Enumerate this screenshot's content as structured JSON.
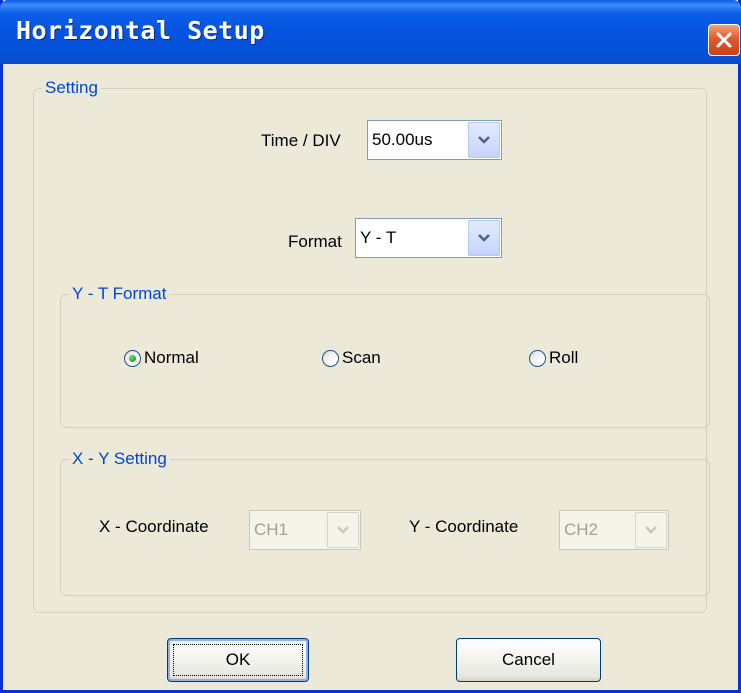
{
  "window": {
    "title": "Horizontal Setup",
    "close_icon": "close-icon"
  },
  "setting": {
    "legend": "Setting",
    "time_div": {
      "label": "Time / DIV",
      "value": "50.00us"
    },
    "format": {
      "label": "Format",
      "value": "Y - T"
    }
  },
  "yt_format": {
    "legend": "Y - T Format",
    "options": [
      {
        "label": "Normal",
        "selected": true
      },
      {
        "label": "Scan",
        "selected": false
      },
      {
        "label": "Roll",
        "selected": false
      }
    ]
  },
  "xy_setting": {
    "legend": "X - Y Setting",
    "x_coordinate": {
      "label": "X - Coordinate",
      "value": "CH1",
      "enabled": false
    },
    "y_coordinate": {
      "label": "Y - Coordinate",
      "value": "CH2",
      "enabled": false
    }
  },
  "buttons": {
    "ok": "OK",
    "cancel": "Cancel"
  },
  "colors": {
    "title_bar": "#0553e0",
    "group_legend": "#0046d5",
    "close_button": "#e05a2f",
    "dialog_bg": "#ece9d8"
  }
}
